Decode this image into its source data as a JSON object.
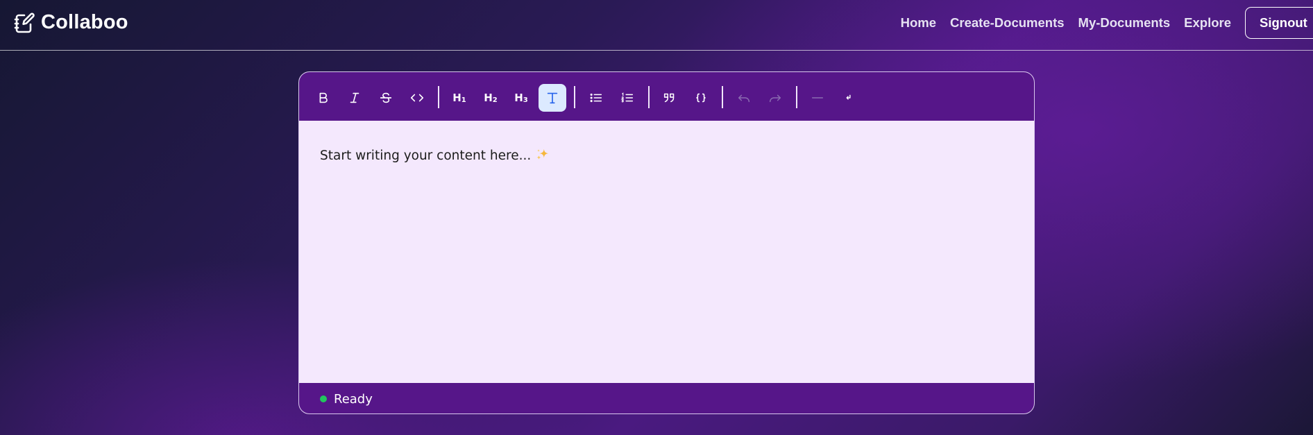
{
  "app": {
    "brand_name": "Collaboo",
    "brand_icon": "notebook-pen-icon"
  },
  "nav": {
    "links": [
      {
        "label": "Home"
      },
      {
        "label": "Create-Documents"
      },
      {
        "label": "My-Documents"
      },
      {
        "label": "Explore"
      }
    ],
    "signout_label": "Signout"
  },
  "toolbar": {
    "buttons": [
      {
        "name": "bold",
        "icon": "bold-icon"
      },
      {
        "name": "italic",
        "icon": "italic-icon"
      },
      {
        "name": "strikethrough",
        "icon": "strikethrough-icon"
      },
      {
        "name": "inline-code",
        "icon": "code-icon"
      },
      {
        "name": "heading-1",
        "label": "H",
        "sub": "1"
      },
      {
        "name": "heading-2",
        "label": "H",
        "sub": "2"
      },
      {
        "name": "heading-3",
        "label": "H",
        "sub": "3"
      },
      {
        "name": "paragraph",
        "icon": "text-t-icon",
        "active": true
      },
      {
        "name": "bullet-list",
        "icon": "bullet-list-icon"
      },
      {
        "name": "ordered-list",
        "icon": "ordered-list-icon"
      },
      {
        "name": "blockquote",
        "icon": "quote-icon"
      },
      {
        "name": "code-block",
        "icon": "braces-icon"
      },
      {
        "name": "undo",
        "icon": "undo-icon",
        "disabled": true
      },
      {
        "name": "redo",
        "icon": "redo-icon",
        "disabled": true
      },
      {
        "name": "horizontal-rule",
        "icon": "horizontal-rule-icon",
        "disabled": true
      },
      {
        "name": "hard-break",
        "icon": "line-break-icon"
      }
    ]
  },
  "editor": {
    "placeholder": "Start writing your content here...",
    "placeholder_icon": "sparkles-icon"
  },
  "status": {
    "text": "Ready",
    "indicator_color": "#22c55e"
  },
  "colors": {
    "toolbar_bg": "#561689",
    "editor_bg": "#f4e8fd",
    "active_button_bg": "#dceaff",
    "active_icon": "#2563eb"
  }
}
